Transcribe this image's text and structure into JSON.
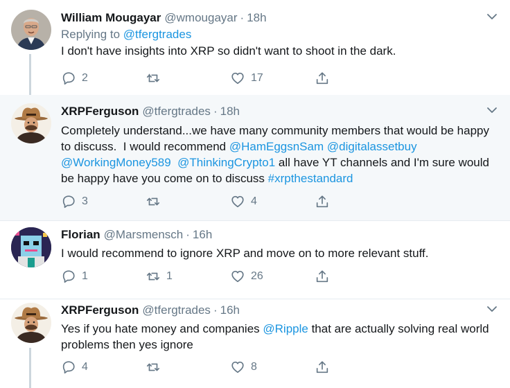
{
  "tweets": [
    {
      "name": "William Mougayar",
      "handle": "@wmougayar",
      "time": "18h",
      "replying_label": "Replying to",
      "replying_handle": "@tfergtrades",
      "text": "I don't have insights into XRP so didn't want to shoot in the dark.",
      "replies": "2",
      "retweets": "",
      "likes": "17"
    },
    {
      "name": "XRPFerguson",
      "handle": "@tfergtrades",
      "time": "18h",
      "text_parts": [
        "Completely understand...we have many community members that would be happy to discuss.  I would recommend ",
        "@HamEggsnSam",
        " ",
        "@digitalassetbuy",
        " ",
        "@WorkingMoney589",
        "  ",
        "@ThinkingCrypto1",
        " all have YT channels and I'm sure would be happy have you come on to discuss ",
        "#xrpthestandard"
      ],
      "replies": "3",
      "retweets": "",
      "likes": "4"
    },
    {
      "name": "Florian",
      "handle": "@Marsmensch",
      "time": "16h",
      "text": "I would recommend to ignore XRP and move on to more relevant stuff.",
      "replies": "1",
      "retweets": "1",
      "likes": "26"
    },
    {
      "name": "XRPFerguson",
      "handle": "@tfergtrades",
      "time": "16h",
      "text_parts": [
        "Yes if you hate money and companies ",
        "@Ripple",
        " that are actually solving real world problems then yes ignore"
      ],
      "replies": "4",
      "retweets": "",
      "likes": "8"
    }
  ],
  "separator": "·",
  "icons": {
    "reply": "reply-icon",
    "retweet": "retweet-icon",
    "like": "like-icon",
    "share": "share-icon",
    "caret": "chevron-down-icon"
  },
  "colors": {
    "link": "#1b95e0",
    "secondary": "#657786",
    "highlight_bg": "#f5f8fa",
    "thread_line": "#ccd6dd"
  }
}
